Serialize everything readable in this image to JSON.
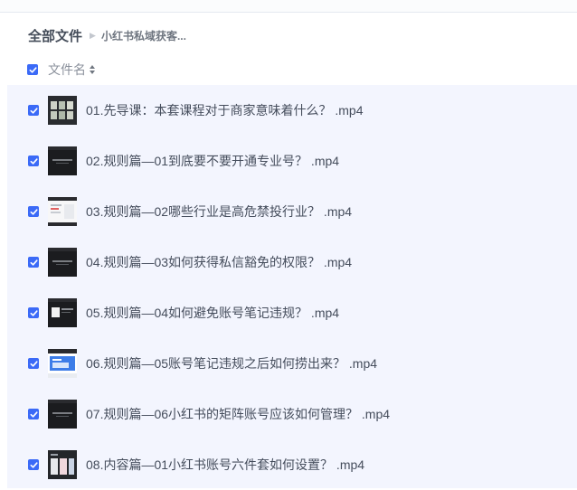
{
  "breadcrumb": {
    "root": "全部文件",
    "current": "小红书私域获客..."
  },
  "list_header": {
    "column_label": "文件名"
  },
  "files": [
    {
      "name": "01.先导课：本套课程对于商家意味着什么？ .mp4",
      "checked": true,
      "thumb": "thumb-grid"
    },
    {
      "name": "02.规则篇—01到底要不要开通专业号？ .mp4",
      "checked": true,
      "thumb": "thumb-dark-title"
    },
    {
      "name": "03.规则篇—02哪些行业是高危禁投行业？ .mp4",
      "checked": true,
      "thumb": "thumb-light-doc"
    },
    {
      "name": "04.规则篇—03如何获得私信豁免的权限？ .mp4",
      "checked": true,
      "thumb": "thumb-dark-title"
    },
    {
      "name": "05.规则篇—04如何避免账号笔记违规？ .mp4",
      "checked": true,
      "thumb": "thumb-dark-screen"
    },
    {
      "name": "06.规则篇—05账号笔记违规之后如何捞出来？ .mp4",
      "checked": true,
      "thumb": "thumb-blue-screen"
    },
    {
      "name": "07.规则篇—06小红书的矩阵账号应该如何管理？ .mp4",
      "checked": true,
      "thumb": "thumb-dark-title"
    },
    {
      "name": "08.内容篇—01小红书账号六件套如何设置？ .mp4",
      "checked": true,
      "thumb": "thumb-phone-screens"
    }
  ],
  "colors": {
    "accent": "#3b6af7",
    "row_bg": "#f3f5fe",
    "text": "#454d5c"
  }
}
